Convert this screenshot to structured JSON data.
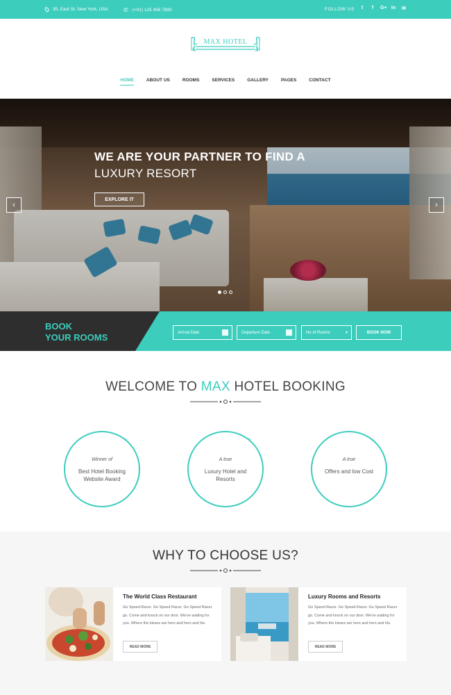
{
  "topbar": {
    "address": "35, East St. New York, USA",
    "phone": "(+01) 125 456 7890",
    "follow": "FOLLOW US",
    "social": [
      {
        "icon": "twitter-icon",
        "glyph": "t"
      },
      {
        "icon": "facebook-icon",
        "glyph": "f"
      },
      {
        "icon": "google-plus-icon",
        "glyph": "G+"
      },
      {
        "icon": "linkedin-icon",
        "glyph": "in"
      },
      {
        "icon": "email-icon",
        "glyph": "✉"
      }
    ]
  },
  "logo": {
    "text": "MAX HOTEL"
  },
  "nav": {
    "items": [
      "HOME",
      "ABOUT US",
      "ROOMS",
      "SERVICES",
      "GALLERY",
      "PAGES",
      "CONTACT"
    ],
    "active": "HOME"
  },
  "hero": {
    "line1": "WE ARE YOUR PARTNER TO FIND A",
    "line2": "LUXURY RESORT",
    "button": "EXPLORE IT",
    "prev": "‹",
    "next": "›"
  },
  "booking": {
    "title1": "BOOK",
    "title2": "YOUR ROOMS",
    "arrival": "Arrival Date",
    "departure": "Departure Date",
    "rooms": "No of Rooms",
    "button": "BOOK NOW"
  },
  "welcome": {
    "pre": "WELCOME TO ",
    "highlight": "MAX",
    "post": " HOTEL BOOKING"
  },
  "features": [
    {
      "small": "Winner of",
      "big": "Best Hotel Booking Website Award",
      "icon": "trophy-icon",
      "glyph": "♆"
    },
    {
      "small": "A true",
      "big": "Luxury Hotel and Resorts",
      "icon": "star-icon",
      "glyph": "✧"
    },
    {
      "small": "A true",
      "big": "Offers and low Cost",
      "icon": "tag-icon",
      "glyph": "♁"
    }
  ],
  "why": {
    "title": "WHY TO CHOOSE US?"
  },
  "cards": [
    {
      "title": "The World Class Restaurant",
      "body": "Go Speed Racer. Go Speed Racer. Go Speed Racer go. Come and knock on our door. We've waiting for you. Where the kisses are hers and hers and his.",
      "button": "READ MORE"
    },
    {
      "title": "Luxury Rooms and Resorts",
      "body": "Go Speed Racer. Go Speed Racer. Go Speed Racer go. Come and knock on our door. We've waiting for you. Where the kisses are hers and hers and his.",
      "button": "READ MORE"
    }
  ],
  "colors": {
    "accent": "#3ccdbd",
    "dark": "#2e2e2e"
  }
}
